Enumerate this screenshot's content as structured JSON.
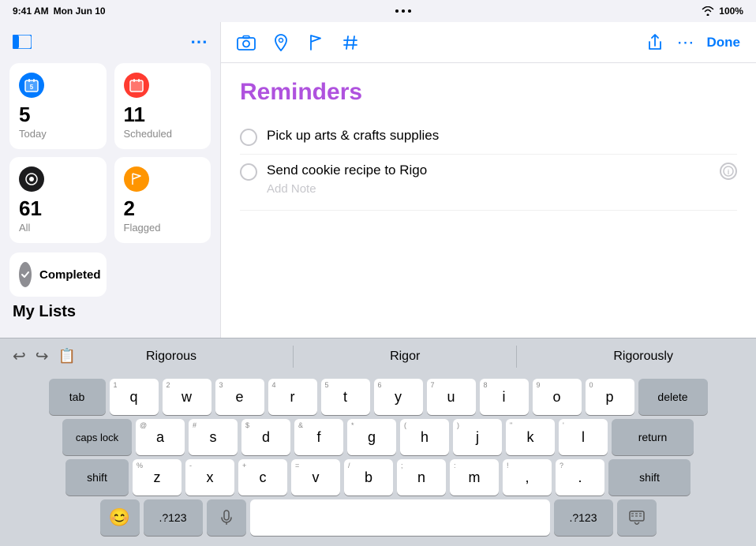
{
  "statusBar": {
    "time": "9:41 AM",
    "date": "Mon Jun 10",
    "dots": "•••",
    "wifi": "WiFi",
    "battery": "100%"
  },
  "sidebar": {
    "moreButton": "•••",
    "smartLists": [
      {
        "id": "today",
        "label": "Today",
        "count": 5,
        "iconColor": "#007aff",
        "iconSymbol": "📅"
      },
      {
        "id": "scheduled",
        "label": "Scheduled",
        "count": 11,
        "iconColor": "#ff3b30",
        "iconSymbol": "📅"
      },
      {
        "id": "all",
        "label": "All",
        "count": 61,
        "iconColor": "#1c1c1e",
        "iconSymbol": "⊙"
      },
      {
        "id": "flagged",
        "label": "Flagged",
        "count": 2,
        "iconColor": "#ff9500",
        "iconSymbol": "⚑"
      }
    ],
    "completed": {
      "label": "Completed"
    },
    "myListsHeader": "My Lists"
  },
  "toolbar": {
    "doneLabel": "Done"
  },
  "reminders": {
    "title": "Reminders",
    "items": [
      {
        "id": 1,
        "text": "Pick up arts & crafts supplies",
        "hasInfo": false
      },
      {
        "id": 2,
        "text": "Send cookie recipe to Rigo",
        "hasInfo": true,
        "addNote": "Add Note"
      }
    ]
  },
  "autocomplete": {
    "suggestions": [
      "Rigorous",
      "Rigor",
      "Rigorously"
    ]
  },
  "keyboard": {
    "row1": [
      {
        "key": "tab",
        "modifier": true
      },
      {
        "key": "q",
        "num": "1"
      },
      {
        "key": "w",
        "num": "2"
      },
      {
        "key": "e",
        "num": "3"
      },
      {
        "key": "r",
        "num": "4"
      },
      {
        "key": "t",
        "num": "5"
      },
      {
        "key": "y",
        "num": "6"
      },
      {
        "key": "u",
        "num": "7"
      },
      {
        "key": "i",
        "num": "8"
      },
      {
        "key": "o",
        "num": "9"
      },
      {
        "key": "p",
        "num": "0"
      },
      {
        "key": "delete",
        "modifier": true
      }
    ],
    "row2": [
      {
        "key": "caps lock",
        "modifier": true
      },
      {
        "key": "a",
        "num": "@"
      },
      {
        "key": "s",
        "num": "#"
      },
      {
        "key": "d",
        "num": "$"
      },
      {
        "key": "f",
        "num": "&"
      },
      {
        "key": "g",
        "num": "*"
      },
      {
        "key": "h",
        "num": "("
      },
      {
        "key": "j",
        "num": ")"
      },
      {
        "key": "k",
        "num": "\""
      },
      {
        "key": "l",
        "num": "'"
      },
      {
        "key": "return",
        "modifier": true
      }
    ],
    "row3": [
      {
        "key": "shift",
        "modifier": true
      },
      {
        "key": "z",
        "num": "%"
      },
      {
        "key": "x",
        "num": "-"
      },
      {
        "key": "c",
        "num": "+"
      },
      {
        "key": "v",
        "num": "="
      },
      {
        "key": "b",
        "num": "/"
      },
      {
        "key": "n",
        "num": ";"
      },
      {
        "key": "m",
        "num": ":"
      },
      {
        "key": "!",
        "num": "!"
      },
      {
        "key": "?",
        "num": "?"
      },
      {
        "key": "shift",
        "modifier": true,
        "right": true
      }
    ],
    "row4": [
      {
        "key": "😊",
        "emoji": true
      },
      {
        "key": ".?123"
      },
      {
        "key": "🎤",
        "mic": true
      },
      {
        "key": "space"
      },
      {
        "key": ".?123"
      },
      {
        "key": "⌨",
        "hide": true
      }
    ]
  }
}
